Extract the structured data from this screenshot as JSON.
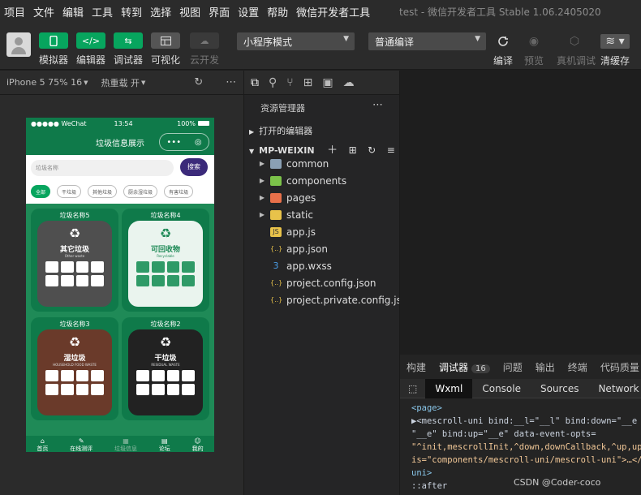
{
  "menubar": {
    "items": [
      "项目",
      "文件",
      "编辑",
      "工具",
      "转到",
      "选择",
      "视图",
      "界面",
      "设置",
      "帮助",
      "微信开发者工具"
    ],
    "window_title": "test - 微信开发者工具 Stable 1.06.2405020"
  },
  "toolbar": {
    "left_buttons": [
      {
        "label": "模拟器",
        "icon": "phone-icon",
        "state": "active"
      },
      {
        "label": "编辑器",
        "icon": "code-icon",
        "state": "active"
      },
      {
        "label": "调试器",
        "icon": "debug-icon",
        "state": "active"
      },
      {
        "label": "可视化",
        "icon": "layout-icon",
        "state": "normal"
      },
      {
        "label": "云开发",
        "icon": "cloud-icon",
        "state": "disabled"
      }
    ],
    "mode_select": "小程序模式",
    "compile_select": "普通编译",
    "right_tools": [
      {
        "label": "编译",
        "icon": "refresh-icon",
        "state": "normal"
      },
      {
        "label": "预览",
        "icon": "eye-icon",
        "state": "disabled"
      },
      {
        "label": "真机调试",
        "icon": "bug-icon",
        "state": "disabled"
      },
      {
        "label": "清缓存",
        "icon": "layers-icon",
        "state": "normal"
      }
    ]
  },
  "simulator": {
    "device": "iPhone 5 75% 16",
    "hot_reload": "热重载 开",
    "status_left": "●●●●● WeChat",
    "status_time": "13:54",
    "status_battery": "100%",
    "nav_title": "垃圾信息展示",
    "search_placeholder": "垃圾名称",
    "search_button": "搜索",
    "tags": [
      "全部",
      "干垃圾",
      "其他垃圾",
      "厨余湿垃圾",
      "有害垃圾"
    ],
    "cards": [
      {
        "title": "垃圾名称5",
        "bin_title": "其它垃圾",
        "bin_sub": "Other waste",
        "color": "#4f4f4f"
      },
      {
        "title": "垃圾名称4",
        "bin_title": "可回收物",
        "bin_sub": "Recyclable",
        "color": "#eaf4ee"
      },
      {
        "title": "垃圾名称3",
        "bin_title": "湿垃圾",
        "bin_sub": "HOUSEHOLD FOOD WASTE",
        "color": "#6a3a2a"
      },
      {
        "title": "垃圾名称2",
        "bin_title": "干垃圾",
        "bin_sub": "RESIDUAL WASTE",
        "color": "#222222"
      }
    ],
    "tabbar": [
      "首页",
      "在线测评",
      "垃圾信息",
      "论坛",
      "我的"
    ]
  },
  "explorer": {
    "header": "资源管理器",
    "open_editors": "打开的编辑器",
    "project": "MP-WEIXIN",
    "items": [
      {
        "name": "common",
        "type": "folder",
        "color": "#8aa0b4"
      },
      {
        "name": "components",
        "type": "folder",
        "color": "#7cc24a"
      },
      {
        "name": "pages",
        "type": "folder",
        "color": "#e8704a"
      },
      {
        "name": "static",
        "type": "folder",
        "color": "#e8c24a"
      },
      {
        "name": "app.js",
        "type": "js",
        "color": "#e8c24a"
      },
      {
        "name": "app.json",
        "type": "json",
        "color": "#e8c24a"
      },
      {
        "name": "app.wxss",
        "type": "wxss",
        "color": "#4a9ee8"
      },
      {
        "name": "project.config.json",
        "type": "json",
        "color": "#e8c24a"
      },
      {
        "name": "project.private.config.js...",
        "type": "json",
        "color": "#e8c24a"
      }
    ]
  },
  "devtools": {
    "tabs": [
      "构建",
      "调试器",
      "问题",
      "输出",
      "终端",
      "代码质量"
    ],
    "debugger_count": "16",
    "panels": [
      "Wxml",
      "Console",
      "Sources",
      "Network"
    ],
    "code_lines": [
      "<page>",
      "▶<mescroll-uni bind:__l=\"__l\" bind:down=\"__e",
      "\"__e\" bind:up=\"__e\" data-event-opts=",
      "\"^init,mescrollInit,^down,downCallback,^up,up",
      "is=\"components/mescroll-uni/mescroll-uni\">…</",
      "uni>",
      "  ::after"
    ]
  },
  "watermark": "CSDN @Coder-coco"
}
